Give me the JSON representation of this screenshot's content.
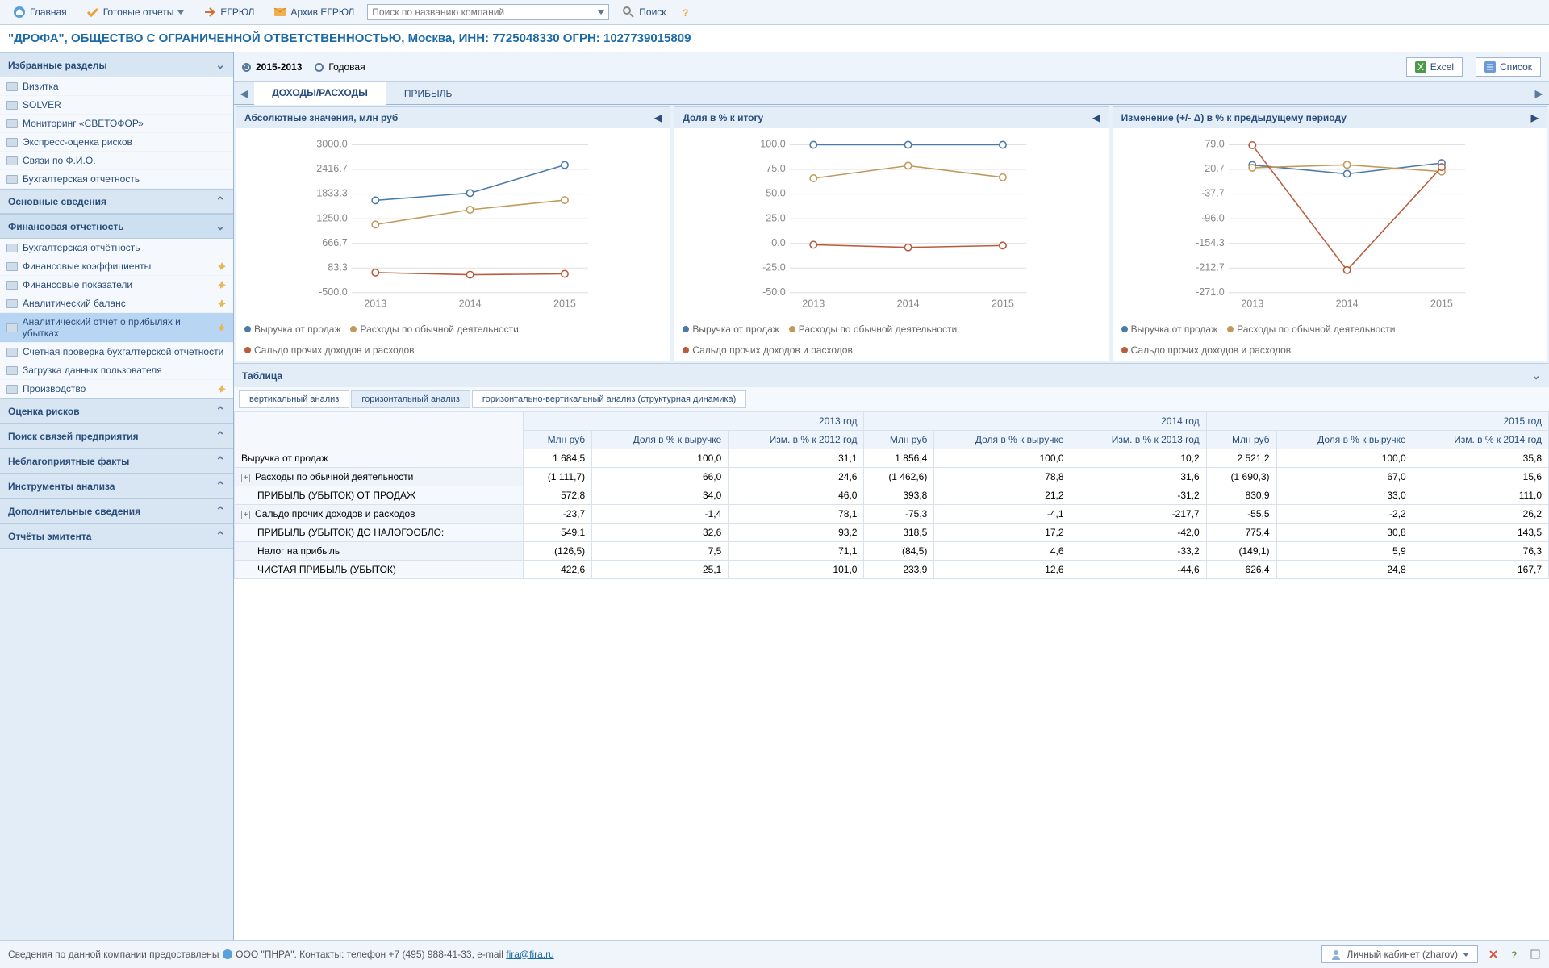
{
  "toolbar": {
    "home": "Главная",
    "reports": "Готовые отчеты",
    "egrul": "ЕГРЮЛ",
    "archive": "Архив ЕГРЮЛ",
    "searchPlaceholder": "Поиск по названию компаний",
    "searchBtn": "Поиск"
  },
  "title": "\"ДРОФА\", ОБЩЕСТВО С ОГРАНИЧЕННОЙ ОТВЕТСТВЕННОСТЬЮ, Москва, ИНН: 7725048330 ОГРН: 1027739015809",
  "favorites": {
    "header": "Избранные разделы",
    "items": [
      "Визитка",
      "SOLVER",
      "Мониторинг «СВЕТОФОР»",
      "Экспресс-оценка рисков",
      "Связи по Ф.И.О.",
      "Бухгалтерская отчетность"
    ]
  },
  "sections": [
    {
      "header": "Основные сведения",
      "collapsed": true
    },
    {
      "header": "Финансовая отчетность",
      "collapsed": false,
      "items": [
        {
          "label": "Бухгалтерская отчётность"
        },
        {
          "label": "Финансовые коэффициенты",
          "pin": true
        },
        {
          "label": "Финансовые показатели",
          "pin": true
        },
        {
          "label": "Аналитический баланс",
          "pin": true
        },
        {
          "label": "Аналитический отчет о прибылях и убытках",
          "pin": true,
          "selected": true
        },
        {
          "label": "Счетная проверка бухгалтерской отчетности"
        },
        {
          "label": "Загрузка данных пользователя"
        },
        {
          "label": "Производство",
          "pin": true
        }
      ]
    },
    {
      "header": "Оценка рисков",
      "collapsed": true
    },
    {
      "header": "Поиск связей предприятия",
      "collapsed": true
    },
    {
      "header": "Неблагоприятные факты",
      "collapsed": true
    },
    {
      "header": "Инструменты анализа",
      "collapsed": true
    },
    {
      "header": "Дополнительные сведения",
      "collapsed": true
    },
    {
      "header": "Отчёты эмитента",
      "collapsed": true
    }
  ],
  "period": {
    "range": "2015-2013",
    "type": "Годовая"
  },
  "actions": {
    "excel": "Excel",
    "list": "Список"
  },
  "mainTabs": {
    "incomeExpense": "ДОХОДЫ/РАСХОДЫ",
    "profit": "ПРИБЫЛЬ"
  },
  "chart_data": [
    {
      "title": "Абсолютные значения, млн руб",
      "type": "line",
      "x": [
        "2013",
        "2014",
        "2015"
      ],
      "ylim": [
        -500,
        3000
      ],
      "series": [
        {
          "name": "Выручка от продаж",
          "color": "#4a7aa8",
          "values": [
            1684.5,
            1856.4,
            2521.2
          ]
        },
        {
          "name": "Расходы по обычной деятельности",
          "color": "#c19a5b",
          "values": [
            1111.7,
            1462.6,
            1690.3
          ]
        },
        {
          "name": "Сальдо прочих доходов и расходов",
          "color": "#b85c3e",
          "values": [
            -23.7,
            -75.3,
            -55.5
          ]
        }
      ]
    },
    {
      "title": "Доля в % к итогу",
      "type": "line",
      "x": [
        "2013",
        "2014",
        "2015"
      ],
      "ylim": [
        -50,
        100
      ],
      "series": [
        {
          "name": "Выручка от продаж",
          "color": "#4a7aa8",
          "values": [
            100,
            100,
            100
          ]
        },
        {
          "name": "Расходы по обычной деятельности",
          "color": "#c19a5b",
          "values": [
            66,
            78.8,
            67
          ]
        },
        {
          "name": "Сальдо прочих доходов и расходов",
          "color": "#b85c3e",
          "values": [
            -1.4,
            -4.1,
            -2.2
          ]
        }
      ]
    },
    {
      "title": "Изменение (+/- Δ) в % к предыдущему периоду",
      "type": "line",
      "x": [
        "2013",
        "2014",
        "2015"
      ],
      "ylim": [
        -271,
        79
      ],
      "series": [
        {
          "name": "Выручка от продаж",
          "color": "#4a7aa8",
          "values": [
            31.1,
            10.2,
            35.8
          ]
        },
        {
          "name": "Расходы по обычной деятельности",
          "color": "#c19a5b",
          "values": [
            24.6,
            31.6,
            15.6
          ]
        },
        {
          "name": "Сальдо прочих доходов и расходов",
          "color": "#b85c3e",
          "values": [
            78.1,
            -217.7,
            26.2
          ]
        }
      ]
    }
  ],
  "legendLabels": [
    "Выручка от продаж",
    "Расходы по обычной деятельности",
    "Сальдо прочих доходов и расходов"
  ],
  "table": {
    "header": "Таблица",
    "analysisTabs": [
      "вертикальный анализ",
      "горизонтальный анализ",
      "горизонтально-вертикальный анализ (структурная динамика)"
    ],
    "yearGroups": [
      "2013 год",
      "2014 год",
      "2015 год"
    ],
    "subCols": [
      "Млн руб",
      "Доля в % к выручке",
      "Изм. в % к 2012 год",
      "Млн руб",
      "Доля в % к выручке",
      "Изм. в % к 2013 год",
      "Млн руб",
      "Доля в % к выручке",
      "Изм. в % к 2014 год"
    ],
    "rows": [
      {
        "label": "Выручка от продаж",
        "cells": [
          "1 684,5",
          "100,0",
          "31,1",
          "1 856,4",
          "100,0",
          "10,2",
          "2 521,2",
          "100,0",
          "35,8"
        ]
      },
      {
        "label": "Расходы по обычной деятельности",
        "expand": true,
        "cells": [
          "(1 111,7)",
          "66,0",
          "24,6",
          "(1 462,6)",
          "78,8",
          "31,6",
          "(1 690,3)",
          "67,0",
          "15,6"
        ]
      },
      {
        "label": "ПРИБЫЛЬ (УБЫТОК) ОТ ПРОДАЖ",
        "sub": true,
        "cells": [
          "572,8",
          "34,0",
          "46,0",
          "393,8",
          "21,2",
          "-31,2",
          "830,9",
          "33,0",
          "111,0"
        ]
      },
      {
        "label": "Сальдо прочих доходов и расходов",
        "expand": true,
        "cells": [
          "-23,7",
          "-1,4",
          "78,1",
          "-75,3",
          "-4,1",
          "-217,7",
          "-55,5",
          "-2,2",
          "26,2"
        ]
      },
      {
        "label": "ПРИБЫЛЬ (УБЫТОК) ДО НАЛОГООБЛО:",
        "sub": true,
        "cells": [
          "549,1",
          "32,6",
          "93,2",
          "318,5",
          "17,2",
          "-42,0",
          "775,4",
          "30,8",
          "143,5"
        ]
      },
      {
        "label": "Налог на прибыль",
        "sub": true,
        "cells": [
          "(126,5)",
          "7,5",
          "71,1",
          "(84,5)",
          "4,6",
          "-33,2",
          "(149,1)",
          "5,9",
          "76,3"
        ]
      },
      {
        "label": "ЧИСТАЯ ПРИБЫЛЬ (УБЫТОК)",
        "sub": true,
        "cells": [
          "422,6",
          "25,1",
          "101,0",
          "233,9",
          "12,6",
          "-44,6",
          "626,4",
          "24,8",
          "167,7"
        ]
      }
    ]
  },
  "footer": {
    "text": "Сведения по данной компании предоставлены",
    "provider": "ООО \"ПНРА\". Контакты: телефон +7 (495) 988-41-33, e-mail",
    "email": "fira@fira.ru",
    "user": "Личный кабинет (zharov)"
  }
}
